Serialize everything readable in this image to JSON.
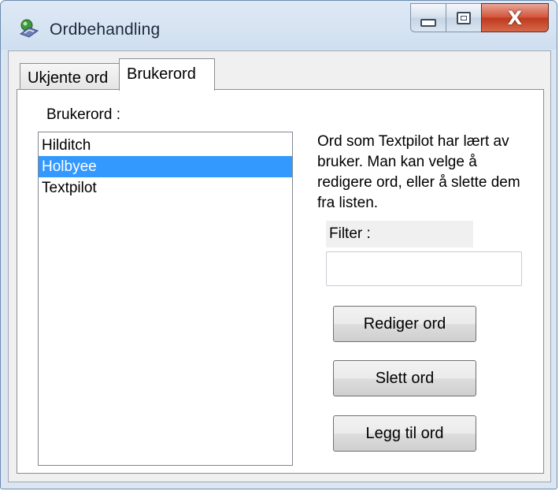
{
  "window": {
    "title": "Ordbehandling",
    "icon": "app-icon",
    "controls": {
      "minimize_icon": "minimize-icon",
      "maximize_icon": "maximize-icon",
      "close_glyph": "X"
    }
  },
  "tabs": [
    {
      "label": "Ukjente ord",
      "selected": false
    },
    {
      "label": "Brukerord",
      "selected": true
    }
  ],
  "panel": {
    "list_label": "Brukerord :",
    "items": [
      {
        "label": "Hilditch",
        "selected": false
      },
      {
        "label": "Holbyee",
        "selected": true
      },
      {
        "label": "Textpilot",
        "selected": false
      }
    ],
    "description": "Ord som Textpilot har lært av bruker. Man kan velge å redigere ord, eller å slette dem fra listen.",
    "filter": {
      "label": "Filter :",
      "value": ""
    },
    "buttons": {
      "edit": "Rediger ord",
      "delete": "Slett ord",
      "add": "Legg til ord"
    }
  },
  "colors": {
    "selection": "#3399ff",
    "close_button": "#c0391f"
  }
}
